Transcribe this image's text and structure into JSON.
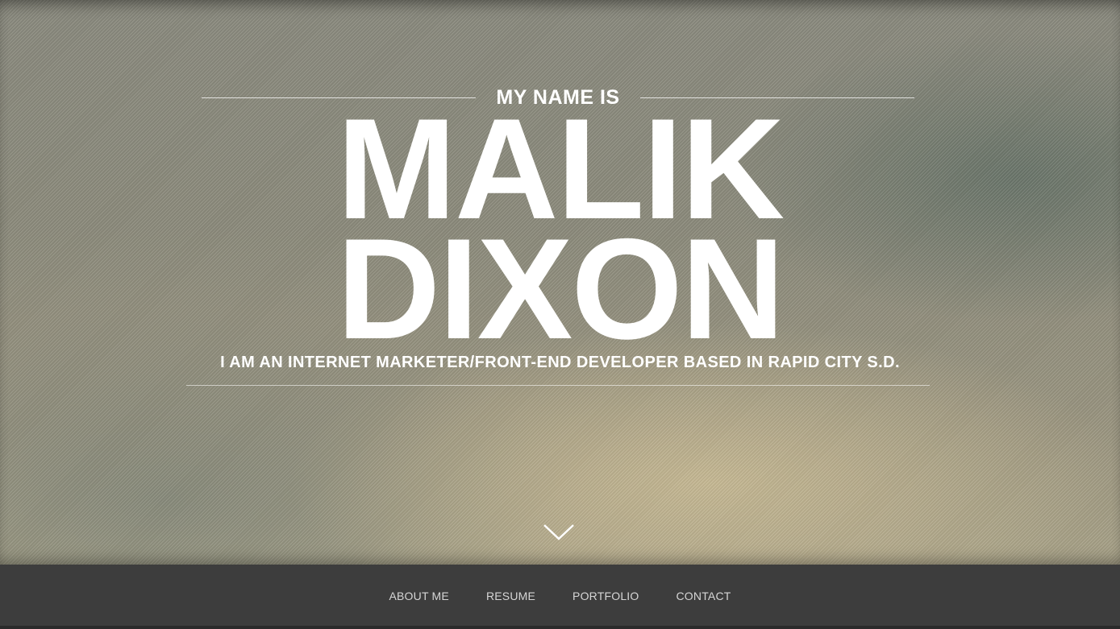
{
  "hero": {
    "intro": "MY NAME IS",
    "first_name": "MALIK",
    "last_name": "DIXON",
    "tagline": "I AM AN INTERNET MARKETER/FRONT-END DEVELOPER BASED IN RAPID CITY S.D.",
    "scroll_icon": "chevron-down-icon"
  },
  "nav": {
    "items": [
      {
        "label": "ABOUT ME"
      },
      {
        "label": "RESUME"
      },
      {
        "label": "PORTFOLIO"
      },
      {
        "label": "CONTACT"
      }
    ]
  },
  "colors": {
    "text": "#ffffff",
    "nav_bg": "#3d3d3d",
    "nav_text": "#d6d6d6"
  }
}
